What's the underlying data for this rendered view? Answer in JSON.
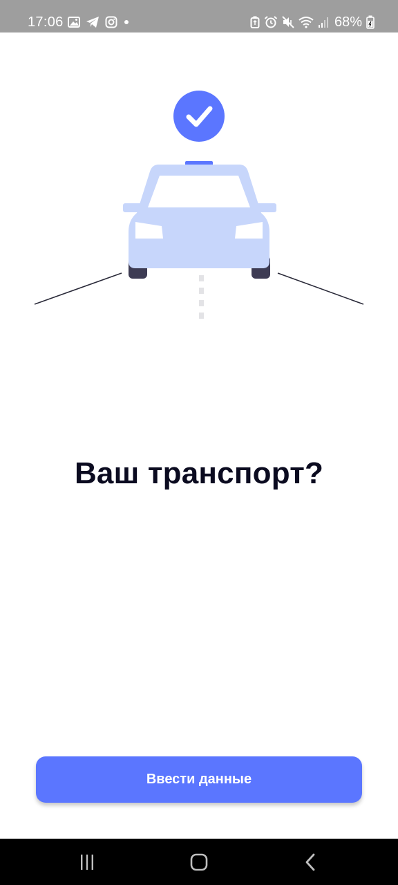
{
  "status_bar": {
    "time": "17:06",
    "notification_icons": [
      "gallery-icon",
      "telegram-icon",
      "instagram-icon",
      "dot-icon"
    ],
    "system_icons": [
      "battery-saver-icon",
      "alarm-icon",
      "mute-icon",
      "wifi-icon",
      "signal-icon"
    ],
    "battery_percent": "68%"
  },
  "main": {
    "headline": "Ваш транспорт?",
    "primary_button_label": "Ввести данные"
  },
  "colors": {
    "accent": "#5b76ff",
    "car_body": "#c7d6fb",
    "headline": "#0b0b20"
  },
  "nav_bar": {
    "buttons": [
      "recent-apps",
      "home",
      "back"
    ]
  }
}
